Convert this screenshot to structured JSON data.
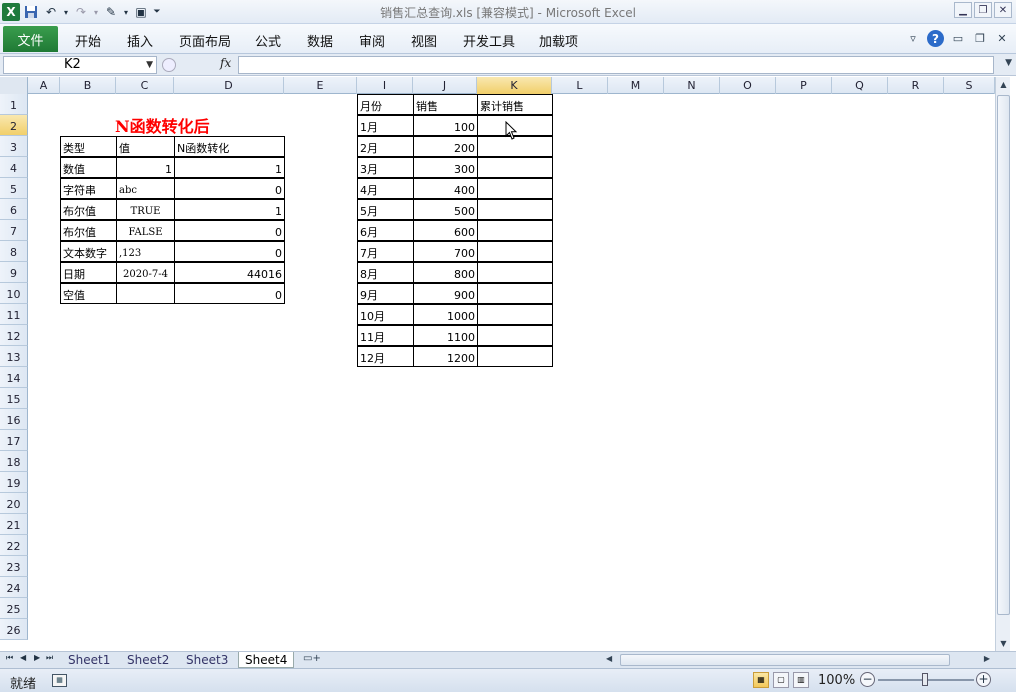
{
  "window": {
    "title": "销售汇总查询.xls  [兼容模式] - Microsoft Excel",
    "app_icon": "X"
  },
  "ribbon": {
    "file_label": "文件",
    "tabs": [
      "开始",
      "插入",
      "页面布局",
      "公式",
      "数据",
      "审阅",
      "视图",
      "开发工具",
      "加载项"
    ]
  },
  "formula_bar": {
    "name_box": "K2",
    "fx_label": "fx",
    "formula": ""
  },
  "columns": [
    "A",
    "B",
    "C",
    "D",
    "E",
    "I",
    "J",
    "K",
    "L",
    "M",
    "N",
    "O",
    "P",
    "Q",
    "R",
    "S"
  ],
  "rows": [
    "1",
    "2",
    "3",
    "4",
    "5",
    "6",
    "7",
    "8",
    "9",
    "10",
    "11",
    "12",
    "13",
    "14",
    "15",
    "16",
    "17",
    "18",
    "19",
    "20",
    "21",
    "22",
    "23",
    "24",
    "25",
    "26"
  ],
  "left_table": {
    "title": "N函数转化后",
    "headers": [
      "类型",
      "值",
      "N函数转化"
    ],
    "rows": [
      {
        "type": "数值",
        "value": "1",
        "result": "1"
      },
      {
        "type": "字符串",
        "value": "abc",
        "result": "0"
      },
      {
        "type": "布尔值",
        "value": "TRUE",
        "result": "1"
      },
      {
        "type": "布尔值",
        "value": "FALSE",
        "result": "0"
      },
      {
        "type": "文本数字",
        "value": ",123",
        "result": "0"
      },
      {
        "type": "日期",
        "value": "2020-7-4",
        "result": "44016"
      },
      {
        "type": "空值",
        "value": "",
        "result": "0"
      }
    ]
  },
  "right_table": {
    "headers": [
      "月份",
      "销售",
      "累计销售"
    ],
    "rows": [
      {
        "month": "1月",
        "sales": "100",
        "cum": ""
      },
      {
        "month": "2月",
        "sales": "200",
        "cum": ""
      },
      {
        "month": "3月",
        "sales": "300",
        "cum": ""
      },
      {
        "month": "4月",
        "sales": "400",
        "cum": ""
      },
      {
        "month": "5月",
        "sales": "500",
        "cum": ""
      },
      {
        "month": "6月",
        "sales": "600",
        "cum": ""
      },
      {
        "month": "7月",
        "sales": "700",
        "cum": ""
      },
      {
        "month": "8月",
        "sales": "800",
        "cum": ""
      },
      {
        "month": "9月",
        "sales": "900",
        "cum": ""
      },
      {
        "month": "10月",
        "sales": "1000",
        "cum": ""
      },
      {
        "month": "11月",
        "sales": "1100",
        "cum": ""
      },
      {
        "month": "12月",
        "sales": "1200",
        "cum": ""
      }
    ]
  },
  "sheets": {
    "tabs": [
      "Sheet1",
      "Sheet2",
      "Sheet3",
      "Sheet4"
    ],
    "active": "Sheet4"
  },
  "status": {
    "ready": "就绪",
    "zoom": "100%"
  },
  "icons": {
    "save": "save-icon",
    "undo": "undo-icon",
    "redo": "redo-icon",
    "help": "help-icon"
  }
}
